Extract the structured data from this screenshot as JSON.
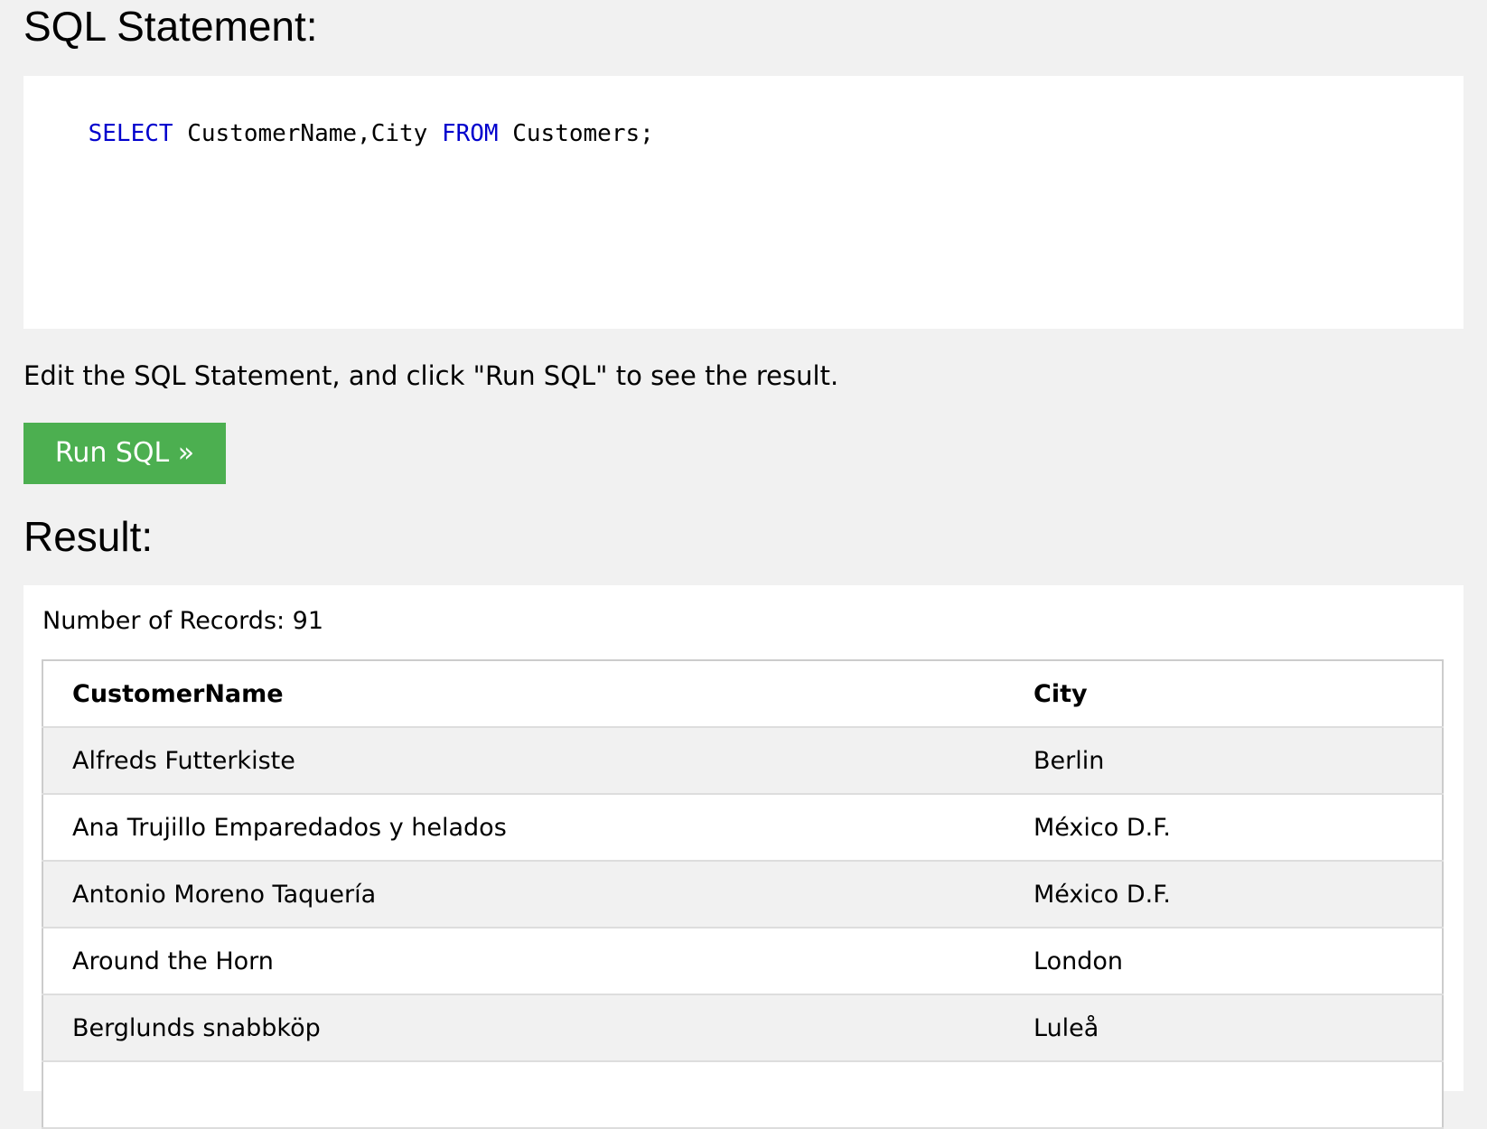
{
  "sql_section": {
    "title": "SQL Statement:",
    "editor": {
      "tokens": [
        {
          "text": "SELECT",
          "keyword": true
        },
        {
          "text": " CustomerName,City ",
          "keyword": false
        },
        {
          "text": "FROM",
          "keyword": true
        },
        {
          "text": " Customers;",
          "keyword": false
        }
      ]
    },
    "hint": "Edit the SQL Statement, and click \"Run SQL\" to see the result.",
    "run_button_label": "Run SQL »"
  },
  "result_section": {
    "title": "Result:",
    "record_count_text": "Number of Records: 91",
    "columns": [
      "CustomerName",
      "City"
    ],
    "rows": [
      [
        "Alfreds Futterkiste",
        "Berlin"
      ],
      [
        "Ana Trujillo Emparedados y helados",
        "México D.F."
      ],
      [
        "Antonio Moreno Taquería",
        "México D.F."
      ],
      [
        "Around the Horn",
        "London"
      ],
      [
        "Berglunds snabbköp",
        "Luleå"
      ],
      [
        "",
        ""
      ]
    ]
  },
  "colors": {
    "page_background": "#f1f1f1",
    "keyword": "#0000cd",
    "run_button": "#4caf50",
    "stripe": "#f1f1f1"
  }
}
